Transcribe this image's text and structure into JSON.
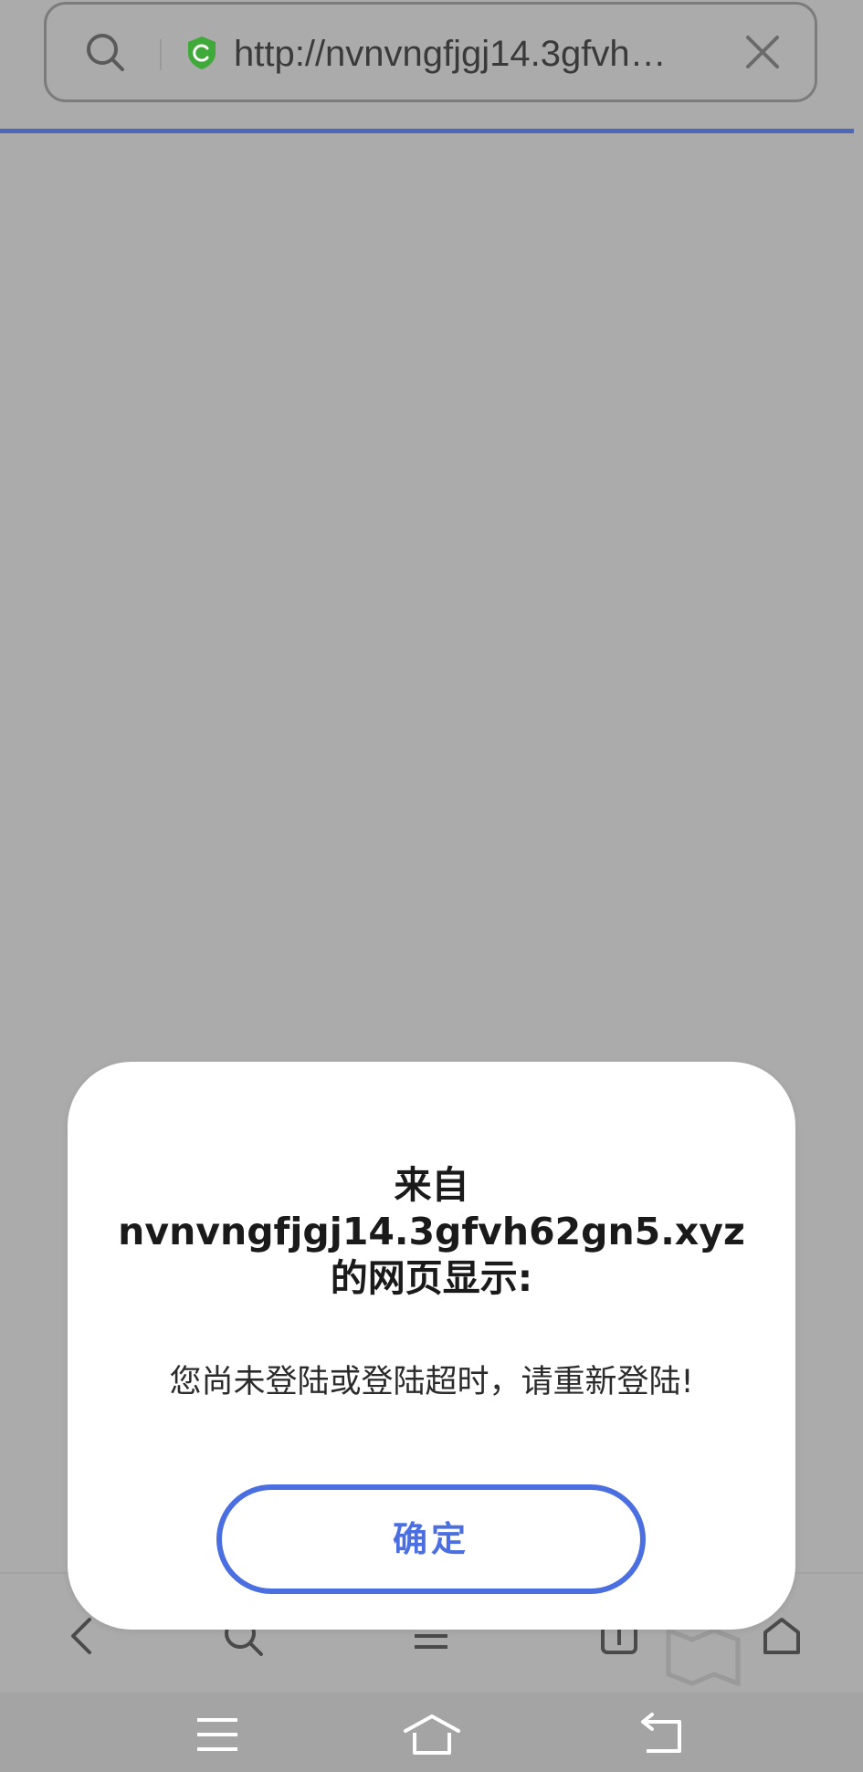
{
  "address_bar": {
    "url": "http://nvnvngfjgj14.3gfvh…",
    "search_icon": "search-icon",
    "security_icon": "shield-icon",
    "close_icon": "close-icon"
  },
  "colors": {
    "progress": "#4d68b8",
    "shield_green": "#3faa3a",
    "accent_blue": "#4b6fe0",
    "overlay_gray": "#ababab"
  },
  "toolbar": {
    "items": [
      "back-icon",
      "search-icon",
      "menu-icon",
      "tabs-icon",
      "home-icon"
    ]
  },
  "system_nav": {
    "items": [
      "recent-apps-icon",
      "home-icon",
      "back-icon"
    ]
  },
  "dialog": {
    "title_line1": "来自",
    "title_line2": "nvnvngfjgj14.3gfvh62gn5.xyz",
    "title_line3": "的网页显示:",
    "message": "您尚未登陆或登陆超时，请重新登陆!",
    "confirm_label": "确定"
  }
}
